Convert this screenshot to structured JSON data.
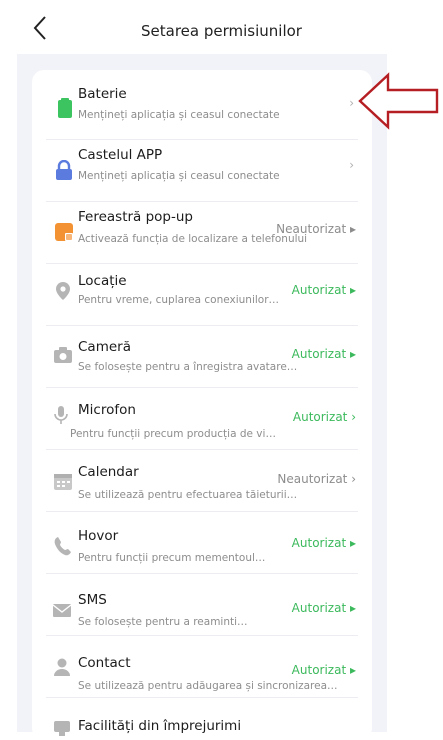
{
  "header": {
    "title": "Setarea permisiunilor",
    "back_icon": "chevron-left-icon"
  },
  "permissions": [
    {
      "title": "Baterie",
      "subtitle": "Mențineți aplicația și ceasul conectate",
      "status": "",
      "icon": "battery-icon",
      "color": "#3cc461"
    },
    {
      "title": "Castelul APP",
      "subtitle": "Mențineți aplicația și ceasul conectate",
      "status": "",
      "icon": "lock-icon",
      "color": "#5b7bdf"
    },
    {
      "title": "Fereastră pop-up",
      "subtitle": "Activează funcția de localizare a telefonului",
      "status": "Neautorizat ▸",
      "icon": "popup-window-icon",
      "color": "#f39233"
    },
    {
      "title": "Locație",
      "subtitle": "Pentru vreme, cuplarea conexiunilor…",
      "status": "Autorizat ▸",
      "icon": "location-pin-icon",
      "color": "#b5b5b5"
    },
    {
      "title": "Cameră",
      "subtitle": "Se folosește pentru a înregistra avatare…",
      "status": "Autorizat ▸",
      "icon": "camera-icon",
      "color": "#b5b5b5"
    },
    {
      "title": "Microfon",
      "subtitle": "Pentru funcții precum producția de vi…",
      "status": "Autorizat ›",
      "icon": "microphone-icon",
      "color": "#b5b5b5"
    },
    {
      "title": "Calendar",
      "subtitle": "Se utilizează pentru efectuarea tăieturii…",
      "status": "Neautorizat ›",
      "icon": "calendar-icon",
      "color": "#b5b5b5"
    },
    {
      "title": "Hovor",
      "subtitle": "Pentru funcții precum mementoul…",
      "status": "Autorizat ▸",
      "icon": "phone-icon",
      "color": "#b5b5b5"
    },
    {
      "title": "SMS",
      "subtitle": "Se folosește pentru a reaminti…",
      "status": "Autorizat ▸",
      "icon": "envelope-icon",
      "color": "#b5b5b5"
    },
    {
      "title": "Contact",
      "subtitle": "Se utilizează pentru adăugarea și sincronizarea…",
      "status": "Autorizat ▸",
      "icon": "person-icon",
      "color": "#b5b5b5"
    },
    {
      "title": "Facilități din împrejurimi",
      "subtitle": "",
      "status": "",
      "icon": "nearby-devices-icon",
      "color": "#b5b5b5"
    }
  ],
  "colors": {
    "authorized": "#3cb95c",
    "unauthorized": "#8d8d8d",
    "annotation_arrow": "#b51e22"
  }
}
